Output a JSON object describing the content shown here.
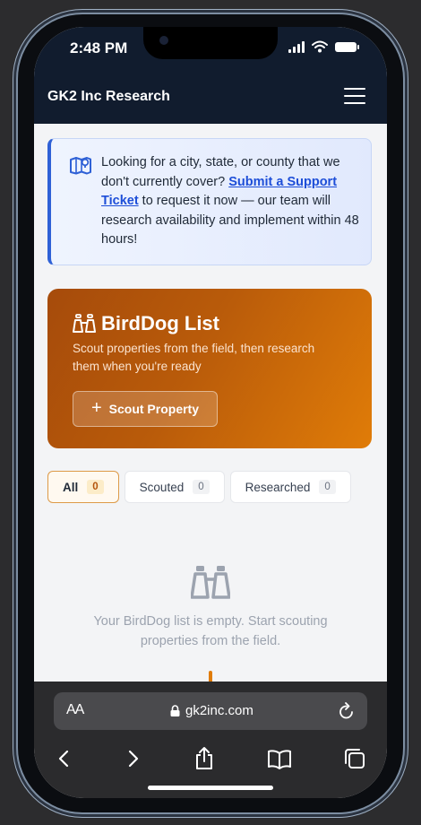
{
  "status": {
    "time": "2:48 PM"
  },
  "app": {
    "title": "GK2 Inc Research"
  },
  "notice": {
    "text_before": "Looking for a city, state, or county that we don't currently cover? ",
    "link": "Submit a Support Ticket",
    "text_after": " to request it now — our team will research availability and implement within 48 hours!"
  },
  "birddog": {
    "title": "BirdDog List",
    "subtitle": "Scout properties from the field, then research them when you're ready",
    "button_label": "Scout Property",
    "button_icon": "plus-icon"
  },
  "tabs": [
    {
      "label": "All",
      "count": "0",
      "active": true
    },
    {
      "label": "Scouted",
      "count": "0",
      "active": false
    },
    {
      "label": "Researched",
      "count": "0",
      "active": false
    }
  ],
  "empty_state": {
    "icon": "binoculars-icon",
    "text": "Your BirdDog list is empty. Start scouting properties from the field."
  },
  "browser": {
    "text_size_label": "AA",
    "url": "gk2inc.com"
  },
  "colors": {
    "header_bg": "#111c2e",
    "accent_orange": "#e07c08",
    "link_blue": "#1d4ed8"
  }
}
